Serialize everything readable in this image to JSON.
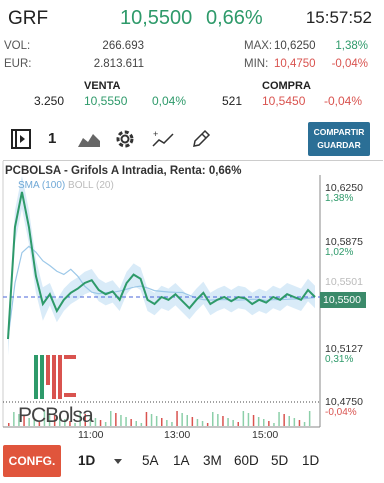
{
  "header": {
    "ticker": "GRF",
    "price": "10,5500",
    "change": "0,66%",
    "time": "15:57:52"
  },
  "stats": {
    "vol_label": "VOL:",
    "vol_value": "266.693",
    "eur_label": "EUR:",
    "eur_value": "2.813.611",
    "max_label": "MAX:",
    "max_value": "10,6250",
    "max_pct": "1,38%",
    "min_label": "MIN:",
    "min_value": "10,4750",
    "min_pct": "-0,04%"
  },
  "book": {
    "sell_header": "VENTA",
    "sell_qty": "3.250",
    "sell_price": "10,5550",
    "sell_pct": "0,04%",
    "buy_header": "COMPRA",
    "buy_qty": "521",
    "buy_price": "10,5450",
    "buy_pct": "-0,04%"
  },
  "toolbar": {
    "count": "1",
    "share_label": "COMPARTIR",
    "save_label": "GUARDAR",
    "icons": [
      "play-frame-icon",
      "area-chart-icon",
      "gear-icon",
      "indicator-icon",
      "pencil-icon"
    ]
  },
  "chart": {
    "title": "PCBOLSA - Grifols A Intradia, Renta: 0,66%",
    "legend_sma": "SMA (100)",
    "legend_boll": "BOLL (20)",
    "watermark": "PCBolsa",
    "price_tag": "10,5500",
    "y_labels": [
      {
        "value": "10,6250",
        "pct": "1,38%"
      },
      {
        "value": "10,5875",
        "pct": "1,02%"
      },
      {
        "value": "10,5501",
        "pct": ""
      },
      {
        "value": "10,5127",
        "pct": "0,31%"
      },
      {
        "value": "10,4750",
        "pct": "-0,04%"
      }
    ],
    "x_labels": [
      "11:00",
      "13:00",
      "15:00"
    ]
  },
  "chart_data": {
    "type": "line",
    "series": [
      {
        "name": "",
        "color": "#2e9a6a",
        "values": [
          10.52,
          10.6,
          10.625,
          10.6,
          10.565,
          10.545,
          10.552,
          10.54,
          10.548,
          10.553,
          10.556,
          10.56,
          10.562,
          10.555,
          10.552,
          10.554,
          10.548,
          10.56,
          10.566,
          10.563,
          10.548,
          10.545,
          10.55,
          10.548,
          10.552,
          10.547,
          10.542,
          10.548,
          10.553,
          10.545,
          10.548,
          10.55,
          10.547,
          10.55,
          10.549,
          10.545,
          10.548,
          10.546,
          10.55,
          10.548,
          10.552,
          10.55,
          10.548,
          10.555,
          10.55
        ]
      }
    ],
    "reference_line": 10.55,
    "ylim": [
      10.475,
      10.625
    ],
    "x_ticks": [
      "11:00",
      "13:00",
      "15:00"
    ]
  },
  "footer": {
    "config_label": "CONFG.",
    "periods": [
      "1D",
      "5A",
      "1A",
      "3M",
      "60D",
      "5D",
      "1D"
    ]
  }
}
